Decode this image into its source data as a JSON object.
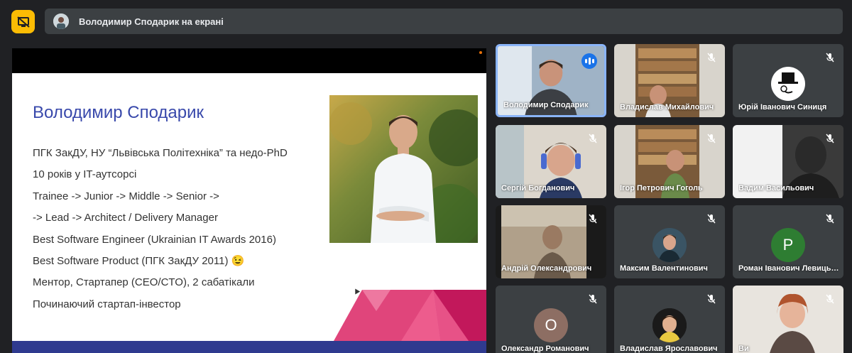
{
  "header": {
    "presenter_text": "Володимир Сподарик на екрані",
    "present_icon": "present-off-icon"
  },
  "slide": {
    "title": "Володимир Сподарик",
    "lines": [
      "ПГК ЗакДУ, НУ “Львівська Політехніка” та недо-PhD",
      "10 років у IT-аутсорсі",
      "Trainee -> Junior -> Middle -> Senior ->",
      "-> Lead -> Architect / Delivery Manager",
      "Best Software Engineer (Ukrainian IT Awards 2016)",
      "Best Software Product (ПГК ЗакДУ 2011) 😉",
      "Ментор, Стартапер (CEO/CTO), 2 сабатікали",
      "Починаючий стартап-інвестор"
    ]
  },
  "participants": [
    {
      "name": "Володимир Сподарик",
      "speaking": true
    },
    {
      "name": "Владислав Михайлович",
      "muted": true
    },
    {
      "name": "Юрій Іванович Синиця",
      "muted": true
    },
    {
      "name": "Сергій Богданович",
      "muted": true
    },
    {
      "name": "Ігор Петрович Гоголь",
      "muted": true
    },
    {
      "name": "Вадим Васильович",
      "muted": true
    },
    {
      "name": "Андрій Олександрович",
      "muted": true
    },
    {
      "name": "Максим Валентинович",
      "muted": true
    },
    {
      "name": "Роман Іванович Левицький",
      "muted": true,
      "initial": "P"
    },
    {
      "name": "Олександр Романович",
      "muted": true,
      "initial": "О"
    },
    {
      "name": "Владислав Ярославович",
      "muted": true
    },
    {
      "name": "Ви",
      "muted": true
    }
  ],
  "colors": {
    "accent": "#fbbc04",
    "active_border": "#8ab4f8",
    "speaking": "#1a73e8",
    "avatar_green": "#2e7d32",
    "avatar_brown": "#8d6e63"
  }
}
